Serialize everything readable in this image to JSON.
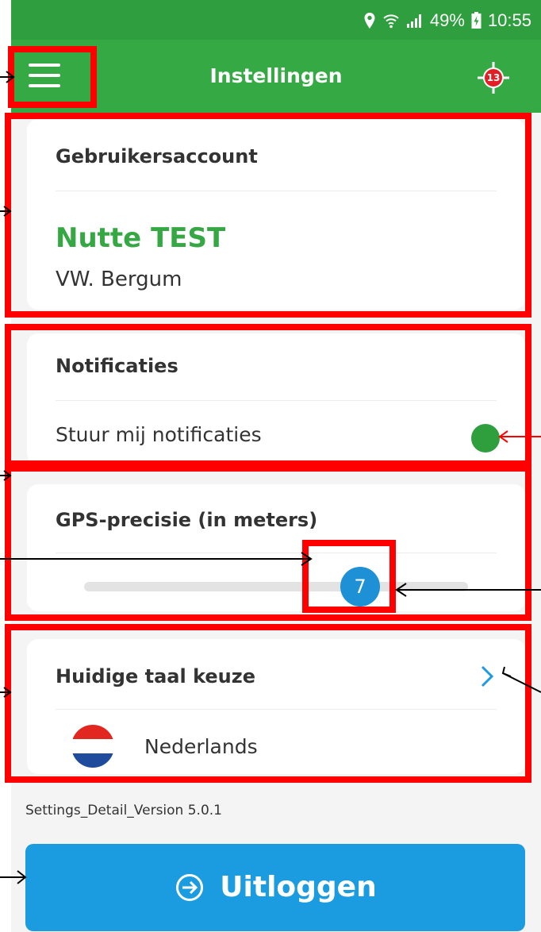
{
  "status_bar": {
    "battery": "49%",
    "time": "10:55"
  },
  "app_bar": {
    "title": "Instellingen",
    "gps_badge_count": "13"
  },
  "account_card": {
    "header": "Gebruikersaccount",
    "user_name": "Nutte TEST",
    "organization": "VW. Bergum"
  },
  "notifications_card": {
    "header": "Notificaties",
    "label": "Stuur mij notificaties",
    "enabled": true
  },
  "gps_card": {
    "header": "GPS-precisie (in meters)",
    "value": "7"
  },
  "language_card": {
    "header": "Huidige taal keuze",
    "language": "Nederlands"
  },
  "version_text": "Settings_Detail_Version 5.0.1",
  "logout_button": {
    "label": "Uitloggen"
  },
  "colors": {
    "app_bar": "#34a944",
    "status_bar": "#2e9e3e",
    "accent_green": "#35a844",
    "slider_thumb": "#1e90d6",
    "logout_button": "#1b9ce1",
    "annotation": "#ff0000"
  },
  "icons": {
    "menu": "hamburger-icon",
    "gps": "gps-target-icon",
    "chevron": "chevron-right-icon",
    "logout": "logout-arrow-icon",
    "flag": "netherlands-flag-icon"
  }
}
